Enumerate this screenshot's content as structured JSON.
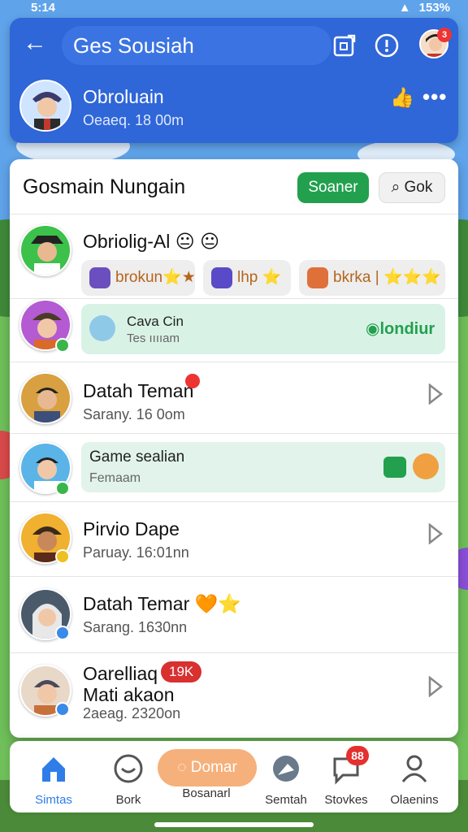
{
  "status_bar": {
    "time": "5:14",
    "battery": "153%",
    "signal": "✆ ⬤ 46"
  },
  "header": {
    "search_text": "Ges Sousiah",
    "chat": {
      "name": "Obroluain",
      "subtitle": "Oeaeq. 18 00m"
    },
    "avatar_badge": "3"
  },
  "list": {
    "title": "Gosmain Nungain",
    "primary_button": "Soaner",
    "search_button": "Gok",
    "rows": [
      {
        "name": "Obriolig-Al 😐 😐",
        "chips": [
          {
            "label": "brokun⭐★"
          },
          {
            "label": "lhp ⭐"
          },
          {
            "label": "bkrka | ⭐⭐⭐"
          }
        ]
      },
      {
        "banner_title": "Cava Cin",
        "banner_sub": "Tes ııııam",
        "banner_action": "londiur"
      },
      {
        "name": "Datah Teman",
        "sub": "Sarany. 16 0om",
        "badge_icon": "pin-icon"
      },
      {
        "banner_title": "Game sealian",
        "banner_sub": "Femaam"
      },
      {
        "name": "Pirvio Dape",
        "sub": "Paruay. 16:01nn"
      },
      {
        "name": "Datah Temar 🧡⭐",
        "sub": "Sarang. 1630nn"
      },
      {
        "name": "Oarelliaq",
        "name2": "Mati akaon",
        "sub": "2aeag. 2320on",
        "count_badge": "19K"
      }
    ]
  },
  "nav": {
    "items": [
      {
        "label": "Simtas"
      },
      {
        "label": "Bork"
      },
      {
        "label": "Bosanarl"
      },
      {
        "label": "Semtah"
      },
      {
        "label": "Stovkes",
        "badge": "88"
      },
      {
        "label": "Olaenins"
      }
    ],
    "center_button": "Domar"
  },
  "colors": {
    "header_blue": "#2f66d8",
    "accent_green": "#22a04d",
    "badge_red": "#e53030"
  }
}
